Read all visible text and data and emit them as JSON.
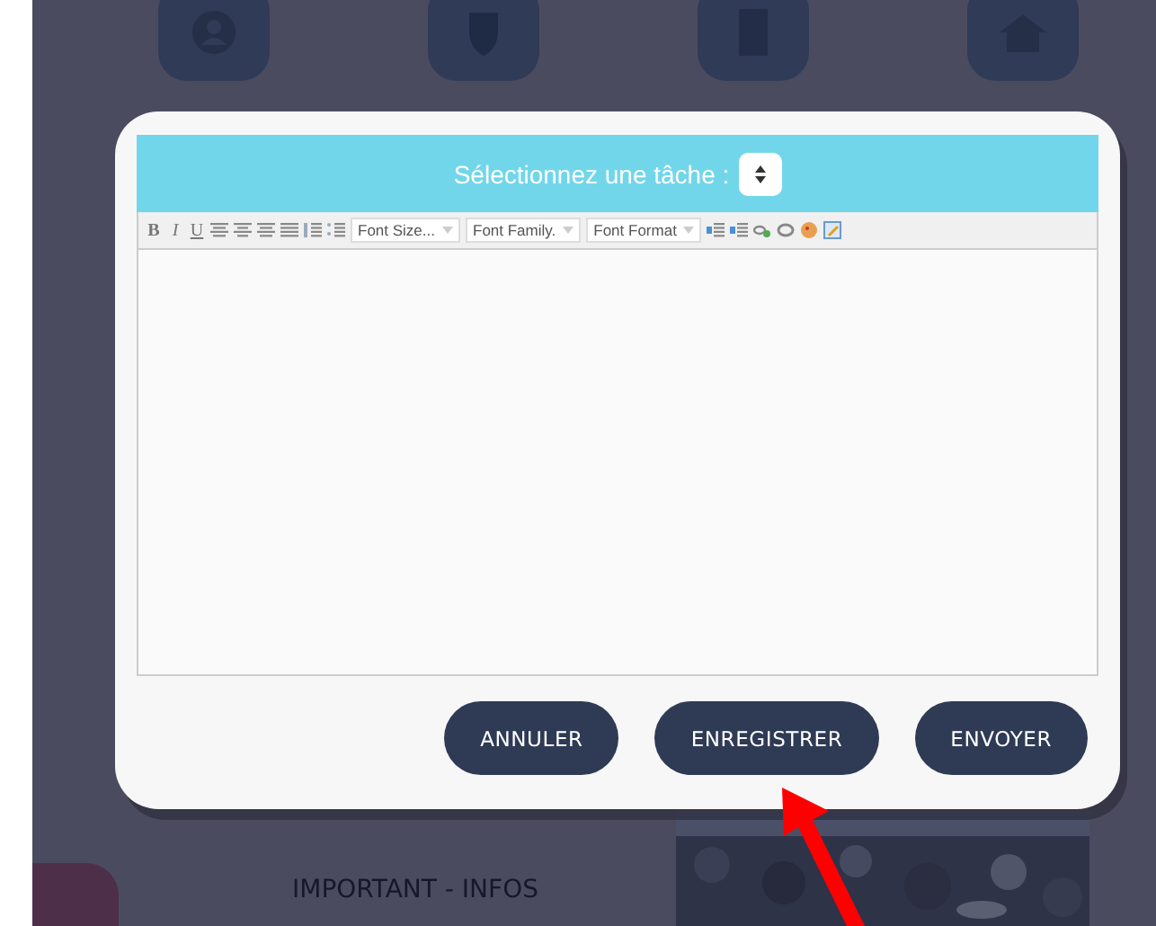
{
  "background": {
    "notice": "IMPORTANT - INFOS"
  },
  "dialog": {
    "header": {
      "label": "Sélectionnez une tâche :"
    },
    "toolbar": {
      "format_buttons": [
        "B",
        "I",
        "U"
      ],
      "dropdowns": [
        "Font Size...",
        "Font Family.",
        "Font Format"
      ]
    },
    "buttons": [
      "ANNULER",
      "ENREGISTRER",
      "ENVOYER"
    ]
  }
}
